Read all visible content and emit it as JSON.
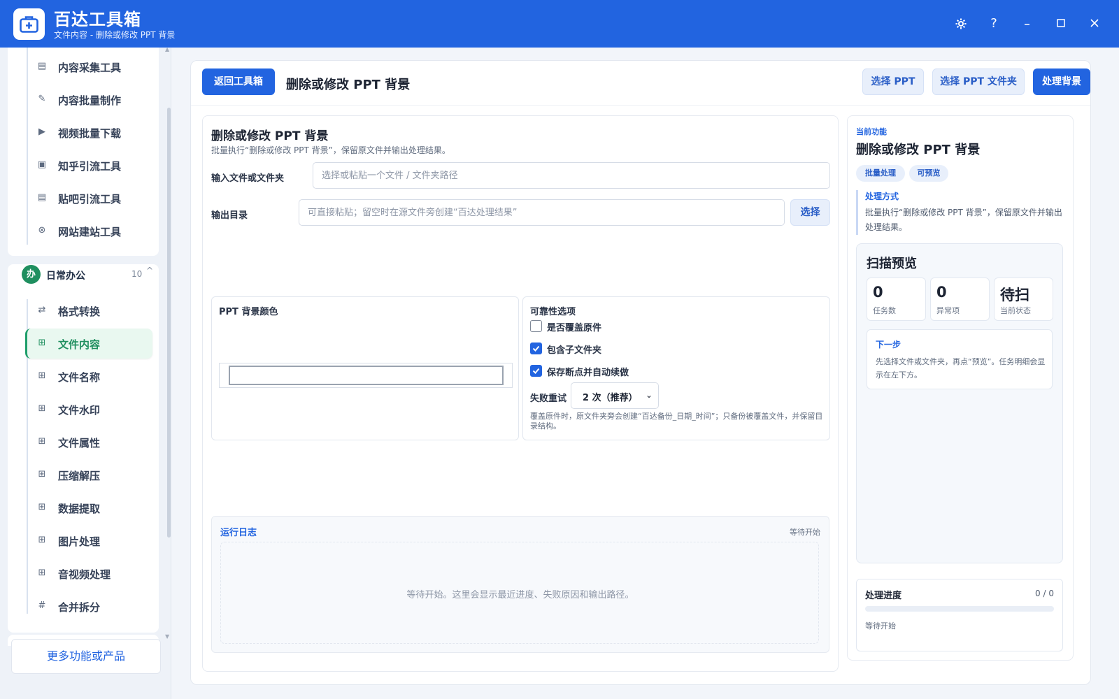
{
  "app": {
    "title": "百达工具箱",
    "subtitle": "文件内容 - 删除或修改 PPT 背景"
  },
  "colors": {
    "accent": "#2264e0",
    "active_green": "#1f8f5f"
  },
  "sidebar": {
    "top_items": [
      {
        "label": "内容采集工具",
        "icon": "collect-icon"
      },
      {
        "label": "内容批量制作",
        "icon": "pen-icon"
      },
      {
        "label": "视频批量下载",
        "icon": "video-download-icon"
      },
      {
        "label": "知乎引流工具",
        "icon": "zhihu-icon"
      },
      {
        "label": "贴吧引流工具",
        "icon": "tieba-icon"
      },
      {
        "label": "网站建站工具",
        "icon": "website-icon"
      }
    ],
    "group": {
      "badge": "办",
      "name": "日常办公",
      "count": "10",
      "caret": "^"
    },
    "group_items": [
      {
        "label": "格式转换",
        "icon": "swap-icon",
        "active": false
      },
      {
        "label": "文件内容",
        "icon": "grid-icon",
        "active": true
      },
      {
        "label": "文件名称",
        "icon": "grid-icon",
        "active": false
      },
      {
        "label": "文件水印",
        "icon": "grid-icon",
        "active": false
      },
      {
        "label": "文件属性",
        "icon": "grid-icon",
        "active": false
      },
      {
        "label": "压缩解压",
        "icon": "grid-icon",
        "active": false
      },
      {
        "label": "数据提取",
        "icon": "grid-icon",
        "active": false
      },
      {
        "label": "图片处理",
        "icon": "grid-icon",
        "active": false
      },
      {
        "label": "音视频处理",
        "icon": "grid-icon",
        "active": false
      },
      {
        "label": "合并拆分",
        "icon": "hash-icon",
        "active": false
      }
    ],
    "more_label": "更多功能或产品"
  },
  "toolbar": {
    "back_label": "返回工具箱",
    "page_title": "删除或修改 PPT 背景",
    "select_ppt_label": "选择 PPT",
    "select_folder_label": "选择 PPT 文件夹",
    "process_label": "处理背景"
  },
  "form": {
    "title": "删除或修改 PPT 背景",
    "desc": "批量执行“删除或修改 PPT 背景”，保留原文件并输出处理结果。",
    "input_label": "输入文件或文件夹",
    "input_placeholder": "选择或粘贴一个文件 / 文件夹路径",
    "output_label": "输出目录",
    "output_placeholder": "可直接粘贴；留空时在源文件旁创建“百达处理结果”",
    "output_button": "选择",
    "color_title": "PPT 背景颜色",
    "reliability_title": "可靠性选项",
    "options": [
      {
        "label": "是否覆盖原件",
        "checked": false
      },
      {
        "label": "包含子文件夹",
        "checked": true
      },
      {
        "label": "保存断点并自动续做",
        "checked": true
      }
    ],
    "retry_label": "失败重试",
    "retry_value": "2 次（推荐）",
    "note": "覆盖原件时，原文件夹旁会创建“百达备份_日期_时间”；只备份被覆盖文件，并保留目录结构。"
  },
  "log": {
    "title": "运行日志",
    "status": "等待开始",
    "empty": "等待开始。这里会显示最近进度、失败原因和输出路径。"
  },
  "info": {
    "kicker": "当前功能",
    "title": "删除或修改 PPT 背景",
    "tags": [
      "批量处理",
      "可预览"
    ],
    "method_title": "处理方式",
    "method_text": "批量执行“删除或修改 PPT 背景”，保留原文件并输出处理结果。",
    "scan_title": "扫描预览",
    "stats": [
      {
        "value": "0",
        "label": "任务数"
      },
      {
        "value": "0",
        "label": "异常项"
      },
      {
        "value": "待扫",
        "label": "当前状态"
      }
    ],
    "next_title": "下一步",
    "next_text": "先选择文件或文件夹，再点“预览”。任务明细会显示在左下方。"
  },
  "progress": {
    "title": "处理进度",
    "count": "0 / 0",
    "fraction": 0,
    "status": "等待开始"
  }
}
